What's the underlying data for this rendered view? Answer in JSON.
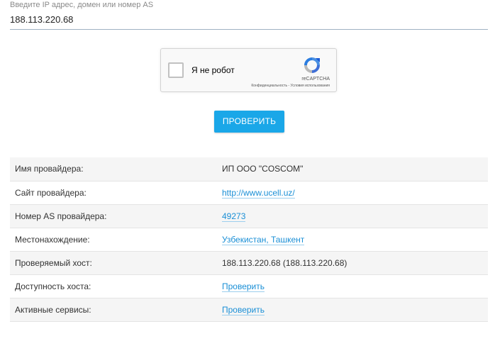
{
  "search": {
    "label": "Введите IP адрес, домен или номер AS",
    "value": "188.113.220.68"
  },
  "captcha": {
    "text": "Я не робот",
    "brand": "reCAPTCHA",
    "privacy": "Конфиденциальность",
    "separator": " - ",
    "terms": "Условия использования",
    "checked": false
  },
  "check_button": {
    "label": "ПРОВЕРИТЬ",
    "color": "#1aa7e8"
  },
  "info": {
    "rows": [
      {
        "key": "Имя провайдера:",
        "value": "ИП ООО \"COSCOM\"",
        "link": false
      },
      {
        "key": "Сайт провайдера:",
        "value": "http://www.ucell.uz/",
        "link": true
      },
      {
        "key": "Номер AS провайдера:",
        "value": "49273",
        "link": true
      },
      {
        "key": "Местонахождение:",
        "value": "Узбекистан, Ташкент",
        "link": true
      },
      {
        "key": "Проверяемый хост:",
        "value": "188.113.220.68 (188.113.220.68)",
        "link": false
      },
      {
        "key": "Доступность хоста:",
        "value": "Проверить",
        "link": true
      },
      {
        "key": "Активные сервисы:",
        "value": "Проверить",
        "link": true
      }
    ]
  },
  "colors": {
    "link": "#1a8fd6",
    "row_alt": "#f5f5f5"
  }
}
